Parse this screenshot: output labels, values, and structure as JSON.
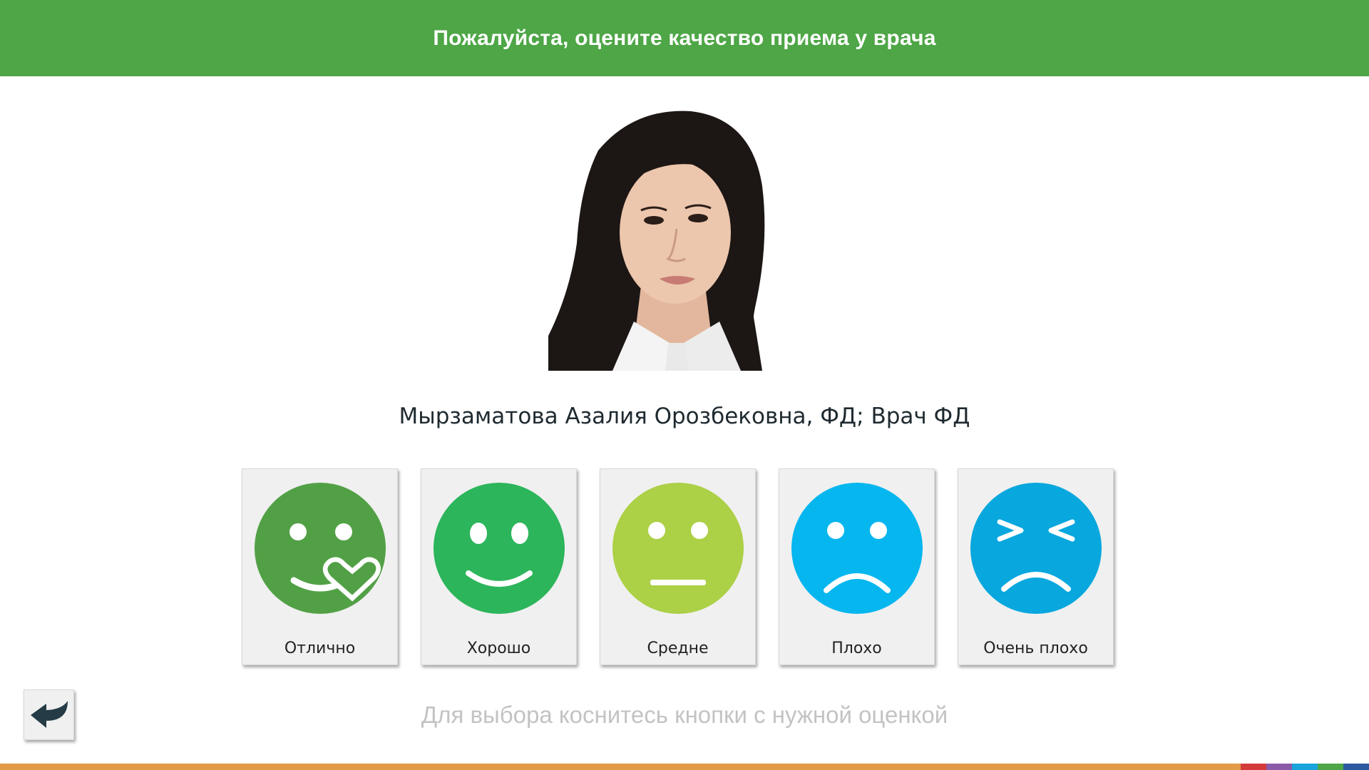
{
  "header": {
    "title": "Пожалуйста, оцените качество приема у врача"
  },
  "doctor": {
    "name": "Мырзаматова Азалия Орозбековна, ФД; Врач ФД"
  },
  "ratings": [
    {
      "label": "Отлично",
      "color": "#52a046",
      "icon": "smile-heart-icon"
    },
    {
      "label": "Хорошо",
      "color": "#2cb55b",
      "icon": "smile-icon"
    },
    {
      "label": "Средне",
      "color": "#acd046",
      "icon": "neutral-face-icon"
    },
    {
      "label": "Плохо",
      "color": "#06b6ef",
      "icon": "sad-face-icon"
    },
    {
      "label": "Очень плохо",
      "color": "#08a7de",
      "icon": "very-sad-face-icon"
    }
  ],
  "hint": "Для выбора коснитесь кнопки с нужной оценкой",
  "back_button": {
    "icon": "back-arrow-icon"
  },
  "colors": {
    "header": "#4ea646",
    "footer_strip": "#e39a47",
    "footer_segments": [
      "#d33b3b",
      "#8b5aa8",
      "#1aa4dc",
      "#4ea646",
      "#2c5aa0"
    ]
  }
}
